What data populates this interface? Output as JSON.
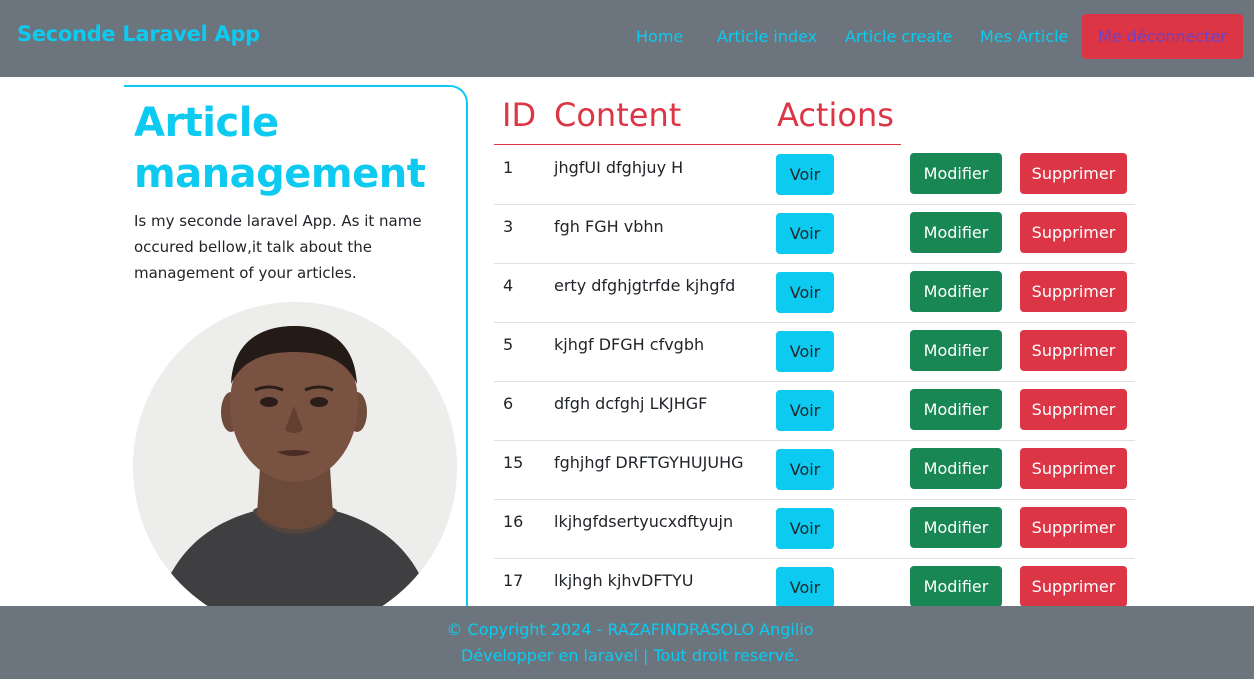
{
  "navbar": {
    "brand": "Seconde Laravel App",
    "links": [
      "Home",
      "Article index",
      "Article create",
      "Mes Article"
    ],
    "logout_label": "Me déconnecter"
  },
  "sidebar": {
    "title": "Article management",
    "description": "Is my seconde laravel App. As it name occured bellow,it talk about the management of your articles."
  },
  "table": {
    "headers": [
      "ID",
      "Content",
      "Actions"
    ],
    "rows": [
      {
        "id": "1",
        "content": "jhgfUI dfghjuy H"
      },
      {
        "id": "3",
        "content": "fgh FGH vbhn"
      },
      {
        "id": "4",
        "content": "erty dfghjgtrfde kjhgfd"
      },
      {
        "id": "5",
        "content": "kjhgf DFGH cfvgbh"
      },
      {
        "id": "6",
        "content": "dfgh dcfghj LKJHGF"
      },
      {
        "id": "15",
        "content": "fghjhgf DRFTGYHUJUHG"
      },
      {
        "id": "16",
        "content": "lkjhgfdsertyucxdftyujn"
      },
      {
        "id": "17",
        "content": "lkjhgh kjhvDFTYU"
      }
    ],
    "actions": {
      "view": "Voir",
      "edit": "Modifier",
      "delete": "Supprimer"
    }
  },
  "footer": {
    "line1": "© Copyright 2024 - RAZAFINDRASOLO Angilio",
    "line2": "Développer en laravel | Tout droit reservé."
  },
  "colors": {
    "navbar_bg": "#6c757d",
    "info": "#0dcaf0",
    "danger": "#dc3545",
    "success": "#198754"
  }
}
